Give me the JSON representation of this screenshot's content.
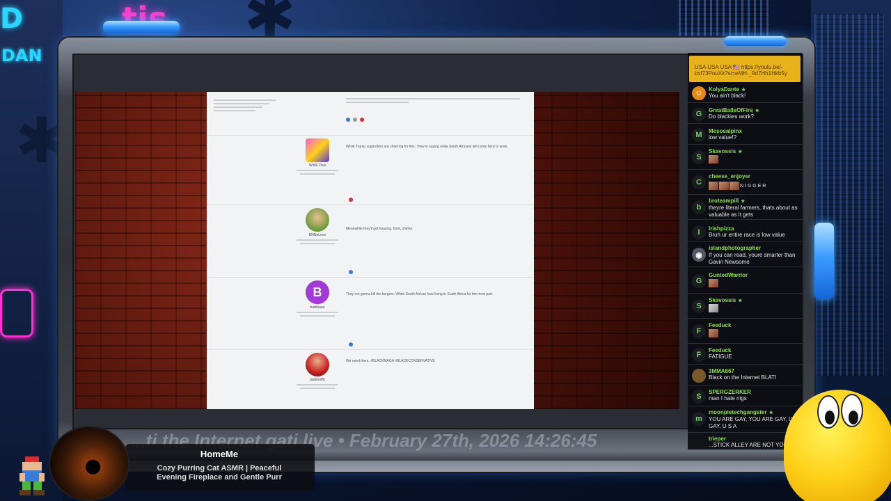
{
  "overlay": {
    "ticker_text": "...ti the Internet gati live • February 27th, 2026 14:26:45",
    "now_playing": {
      "user": "HomeMe",
      "title": "Cozy Purring Cat ASMR | Peaceful Evening Fireplace and Gentle Purr"
    }
  },
  "chat": {
    "pinned": "USA USA USA 🇺🇸 https://youtu.be/-bxf73PnuXk?si=eMH-_9d7Hh1Hkb5y",
    "messages": [
      {
        "badge": "",
        "user": "KolyaDante",
        "text": "You ain't black!"
      },
      {
        "badge": "G",
        "user": "GreatBallsOfFire",
        "text": "Do blackies work?"
      },
      {
        "badge": "M",
        "user": "Mesosalpinx",
        "text": "low value!?"
      },
      {
        "badge": "S",
        "user": "Skavossis",
        "text": ""
      },
      {
        "badge": "C",
        "user": "cheese_enjoyer",
        "text": "N  I  G  G  E  R"
      },
      {
        "badge": "b",
        "user": "broteampill",
        "text": "theyre literal farmers, thats about as valuable as it gets"
      },
      {
        "badge": "I",
        "user": "Irishpizza",
        "text": "Bruh ur entire race is low value"
      },
      {
        "badge": "",
        "user": "islandphotographer",
        "text": "If you can read, youre smarter than Gavin Newsome"
      },
      {
        "badge": "G",
        "user": "GuntedWarrior",
        "text": ""
      },
      {
        "badge": "S",
        "user": "Skavossis",
        "text": ""
      },
      {
        "badge": "F",
        "user": "Feeduck",
        "text": ""
      },
      {
        "badge": "F",
        "user": "Feeduck",
        "text": "FATIGUE"
      },
      {
        "badge": "",
        "user": "3MMA667",
        "text": "Black on the Internet BLATI"
      },
      {
        "badge": "S",
        "user": "SPERGZERKER",
        "text": "man I hate nigs"
      },
      {
        "badge": "m",
        "user": "moonpietechgangster",
        "text": "YOU ARE GAY, YOU ARE GAY, U R GAY, U S A"
      },
      {
        "badge": "",
        "user": "trieper",
        "text": "...STICK ALLEY ARE NOT YOU..."
      }
    ]
  },
  "forum": {
    "posts": [
      {
        "user": "WWE Diva",
        "text": "While Trump supporters are cheering for this. They're saying white South Africans will come here to work."
      },
      {
        "user": "BNNoLove",
        "text": "Meanwhile they'll get housing, food, shelter."
      },
      {
        "user": "bumbaaa",
        "text": "They not gonna kill the burgers. White South African love living in South Africa for the most part."
      },
      {
        "user": "jawknoff6",
        "text": "We need them. #BLACKMAGA #BLACKCONSERVATIVE"
      }
    ]
  },
  "colors": {
    "accent_green": "#8fe04a",
    "pinned_bg": "#e8b21a",
    "frame_blue": "#3a9cff"
  }
}
